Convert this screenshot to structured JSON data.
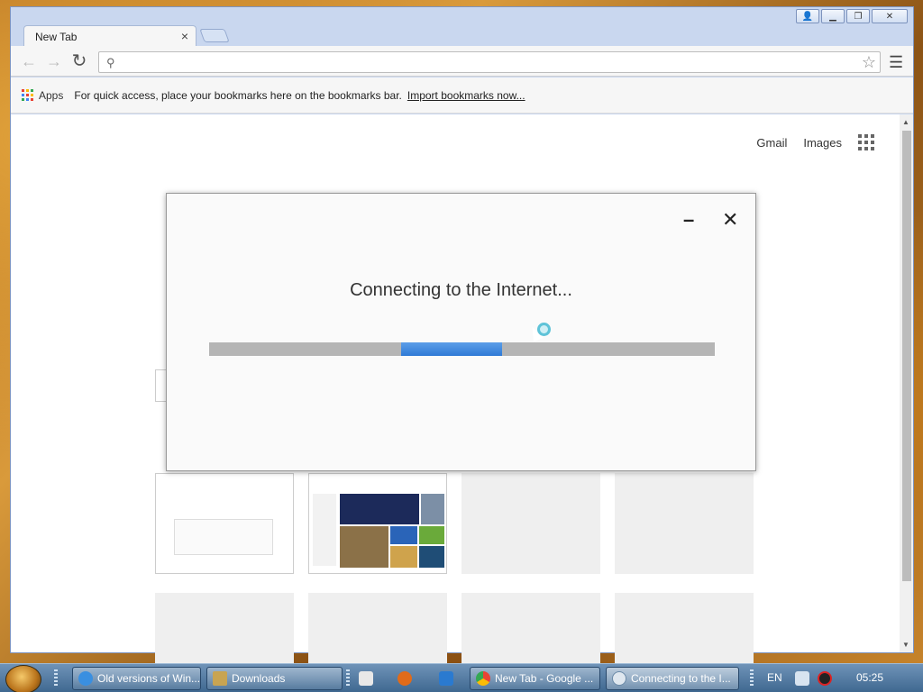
{
  "browser": {
    "tab_title": "New Tab",
    "tab_close": "×",
    "omnibox": {
      "placeholder": "",
      "value": ""
    },
    "bookmarks_bar": {
      "apps_label": "Apps",
      "hint": "For quick access, place your bookmarks here on the bookmarks bar.",
      "import_link": "Import bookmarks now..."
    },
    "top_links": {
      "gmail": "Gmail",
      "images": "Images"
    },
    "window_controls": {
      "user": "👤",
      "minimize": "▁",
      "restore": "❐",
      "close": "✕"
    }
  },
  "dialog": {
    "message": "Connecting to the Internet...",
    "minimize": "–",
    "close": "✕",
    "progress_fraction": 0.2,
    "progress_color": "#2f7ad6"
  },
  "taskbar": {
    "buttons": [
      {
        "label": "Old versions of Win...",
        "icon": "ie-icon"
      },
      {
        "label": "Downloads",
        "icon": "folder-icon"
      },
      {
        "label": "New Tab - Google ...",
        "icon": "chrome-icon"
      },
      {
        "label": "Connecting to the I...",
        "icon": "installer-icon"
      }
    ],
    "language": "EN",
    "clock": "05:25"
  },
  "colors": {
    "apps_grid": [
      "#ea4335",
      "#fbbc05",
      "#34a853",
      "#4285f4",
      "#ea4335",
      "#fbbc05",
      "#34a853",
      "#4285f4",
      "#ea4335"
    ]
  }
}
